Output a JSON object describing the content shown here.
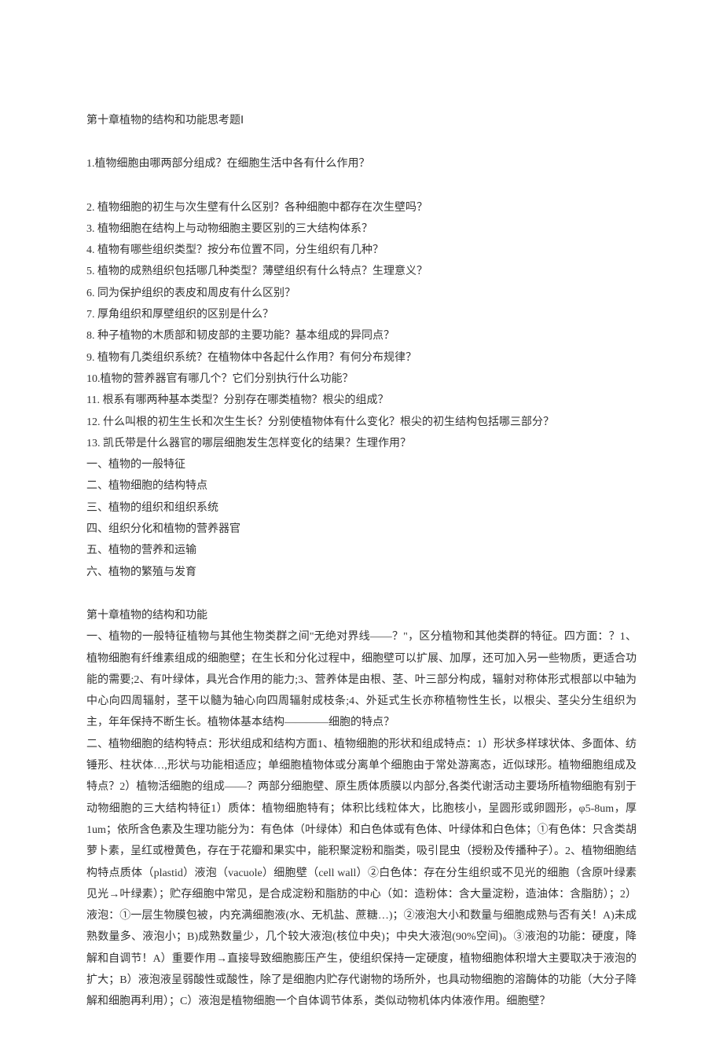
{
  "header": {
    "title": "第十章植物的结构和功能思考题Ⅰ"
  },
  "questions": {
    "q1": "1.植物细胞由哪两部分组成？在细胞生活中各有什么作用？",
    "items": [
      "2. 植物细胞的初生与次生壁有什么区别？各种细胞中都存在次生壁吗？",
      "3. 植物细胞在结构上与动物细胞主要区别的三大结构体系？",
      "4. 植物有哪些组织类型？按分布位置不同，分生组织有几种？",
      "5. 植物的成熟组织包括哪几种类型？薄壁组织有什么特点？生理意义？",
      "6. 同为保护组织的表皮和周皮有什么区别？",
      "7. 厚角组织和厚壁组织的区别是什么？",
      "8. 种子植物的木质部和韧皮部的主要功能？基本组成的异同点？",
      "9. 植物有几类组织系统？在植物体中各起什么作用？有何分布规律？",
      "10.植物的营养器官有哪几个？它们分别执行什么功能？",
      "11. 根系有哪两种基本类型？分别存在哪类植物？根尖的组成？",
      "12. 什么叫根的初生生长和次生生长？分别使植物体有什么变化？根尖的初生结构包括哪三部分？",
      "13. 凯氏带是什么器官的哪层细胞发生怎样变化的结果？生理作用？"
    ]
  },
  "outline": {
    "items": [
      "一、植物的一般特征",
      "二、植物细胞的结构特点",
      "三、植物的组织和组织系统",
      "四、组织分化和植物的营养器官",
      "五、植物的营养和运输",
      "六、植物的繁殖与发育"
    ]
  },
  "section2": {
    "title": "第十章植物的结构和功能",
    "paragraphs": [
      "一、植物的一般特征植物与其他生物类群之间\"无绝对界线——？\"，区分植物和其他类群的特征。四方面：？1、植物细胞有纤维素组成的细胞壁；在生长和分化过程中，细胞壁可以扩展、加厚，还可加入另一些物质，更适合功能的需要;2、有叶绿体，具光合作用的能力;3、营养体是由根、茎、叶三部分构成，辐射对称体形式根部以中轴为中心向四周辐射，茎干以髓为轴心向四周辐射成枝条;4、外延式生长亦称植物性生长，以根尖、茎尖分生组织为主，年年保持不断生长。植物体基本结构————细胞的特点？",
      "二、植物细胞的结构特点：形状组成和结构方面1、植物细胞的形状和组成特点：1）形状多样球状体、多面体、纺锤形、柱状体…,形状与功能相适应；单细胞植物体或分离单个细胞由于常处游离态，近似球形。植物细胞组成及特点？2）植物活细胞的组成——？两部分细胞壁、原生质体质膜以内部分,各类代谢活动主要场所植物细胞有别于动物细胞的三大结构特征1）质体：植物细胞特有；体积比线粒体大，比胞核小，呈圆形或卵圆形，φ5-8um，厚1um；依所含色素及生理功能分为：有色体（叶绿体）和白色体或有色体、叶绿体和白色体；①有色体：只含类胡萝卜素，呈红或橙黄色，存在于花瓣和果实中，能积聚淀粉和脂类，吸引昆虫（授粉及传播种子）。2、植物细胞结构特点质体（plastid）液泡（vacuole）细胞壁（cell wall）②白色体：存在分生组织或不见光的细胞（含原叶绿素见光→叶绿素）；贮存细胞中常见，是合成淀粉和脂肪的中心（如：造粉体：含大量淀粉，造油体：含脂肪）；2）液泡：①一层生物膜包被，内充满细胞液(水、无机盐、蔗糖…)；②液泡大小和数量与细胞成熟与否有关！A)未成熟数量多、液泡小；B)成熟数量少，几个较大液泡(核位中央)；中央大液泡(90%空间)。③液泡的功能：硬度，降解和自调节！A）重要作用→直接导致细胞膨压产生，使组织保持一定硬度，植物细胞体积增大主要取决于液泡的扩大；B）液泡液呈弱酸性或酸性，除了是细胞内贮存代谢物的场所外，也具动物细胞的溶酶体的功能（大分子降解和细胞再利用）；C）液泡是植物细胞一个自体调节体系，类似动物机体内体液作用。细胞壁？"
    ]
  }
}
